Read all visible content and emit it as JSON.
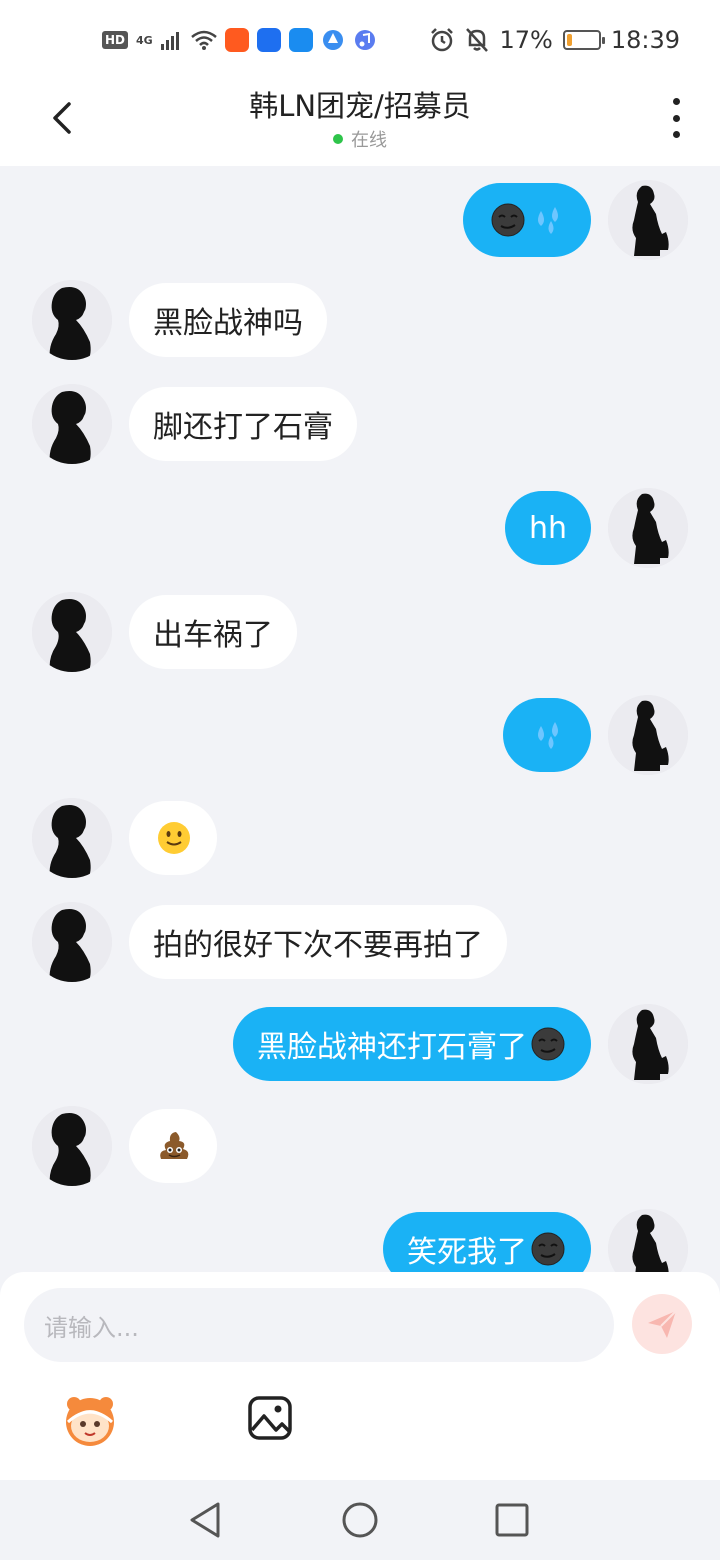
{
  "status_bar": {
    "hd_badge": "HD",
    "network": "4G",
    "battery": "17%",
    "battery_level": 0.17,
    "time": "18:39"
  },
  "header": {
    "title": "韩LN团宠/招募员",
    "status": "在线"
  },
  "messages": [
    {
      "side": "out",
      "text": "",
      "emojis": [
        "new-moon-face",
        "sweat-droplets"
      ]
    },
    {
      "side": "in",
      "text": "黑脸战神吗",
      "emojis": []
    },
    {
      "side": "in",
      "text": "脚还打了石膏",
      "emojis": []
    },
    {
      "side": "out",
      "text": "hh",
      "emojis": []
    },
    {
      "side": "in",
      "text": "出车祸了",
      "emojis": []
    },
    {
      "side": "out",
      "text": "",
      "emojis": [
        "sweat-droplets"
      ]
    },
    {
      "side": "in",
      "text": "",
      "emojis": [
        "slightly-smiling-face"
      ]
    },
    {
      "side": "in",
      "text": "拍的很好下次不要再拍了",
      "emojis": []
    },
    {
      "side": "out",
      "text": "黑脸战神还打石膏了",
      "emojis": [
        "new-moon-face"
      ]
    },
    {
      "side": "in",
      "text": "",
      "emojis": [
        "pile-of-poo"
      ]
    },
    {
      "side": "out",
      "text": "笑死我了",
      "emojis": [
        "new-moon-face"
      ]
    }
  ],
  "input": {
    "placeholder": "请输入..."
  },
  "colors": {
    "outgoing_bubble": "#1ab2f5",
    "incoming_bubble": "#ffffff",
    "background": "#f2f3f7",
    "online_dot": "#2ec44a"
  }
}
